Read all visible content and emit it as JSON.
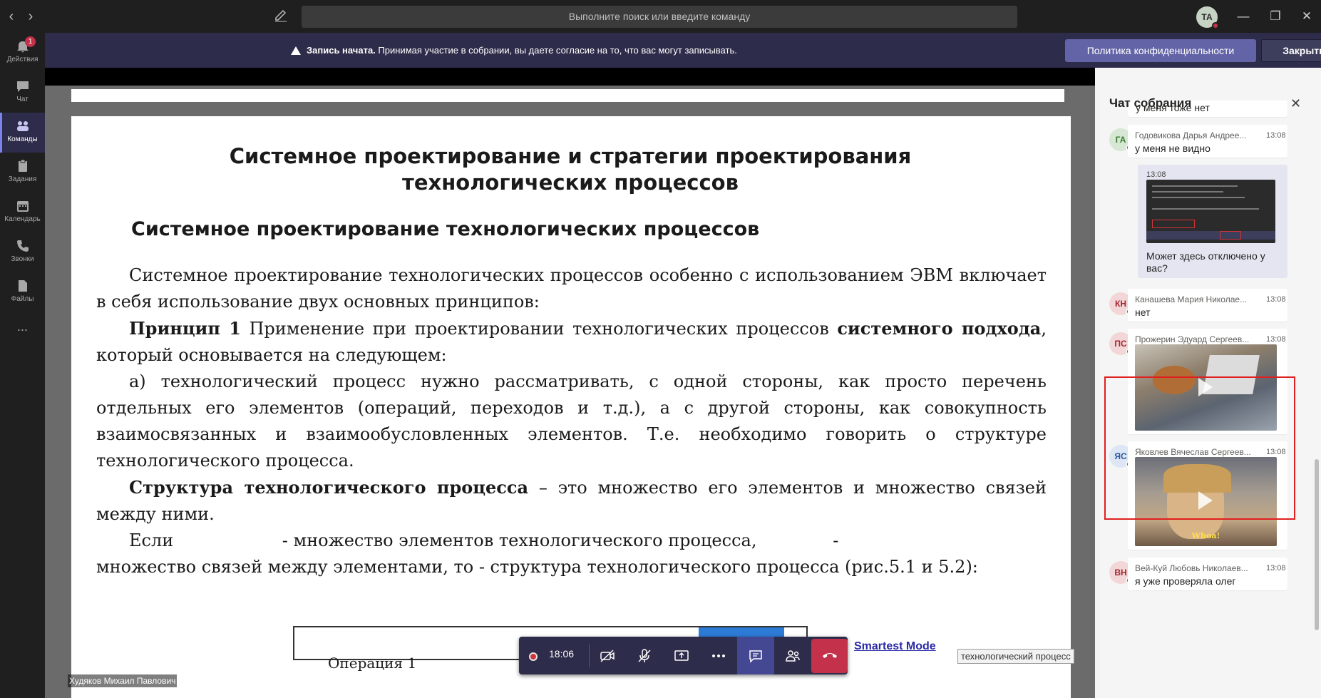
{
  "titlebar": {
    "search_placeholder": "Выполните поиск или введите команду",
    "avatar_initials": "ТА"
  },
  "rail": {
    "items": [
      {
        "label": "Действия",
        "badge": "1"
      },
      {
        "label": "Чат"
      },
      {
        "label": "Команды"
      },
      {
        "label": "Задания"
      },
      {
        "label": "Календарь"
      },
      {
        "label": "Звонки"
      },
      {
        "label": "Файлы"
      }
    ],
    "more": "..."
  },
  "banner": {
    "title": "Запись начата.",
    "text": "Принимая участие в собрании, вы даете согласие на то, что вас могут записывать.",
    "privacy_label": "Политика конфиденциальности",
    "close_label": "Закрыть"
  },
  "document": {
    "title": "Системное проектирование и стратегии проектирования технологических процессов",
    "subtitle": "Системное проектирование технологических процессов",
    "p1": "Системное проектирование технологических процессов особенно с использованием ЭВМ включает в себя использование двух основных принципов:",
    "p2_bold": "Принцип 1",
    "p2": " Применение при проектировании технологических процессов ",
    "p2_bold2": "системного подхода",
    "p2_end": ", который основывается на следующем:",
    "p3": "а) технологический процесс нужно рассматривать, с одной стороны, как просто перечень отдельных его элементов (операций, переходов и т.д.), а с другой стороны, как совокупность взаимосвязанных и взаимообусловленных элементов. Т.е. необходимо говорить о структуре технологического процесса.",
    "p4_bold": "Структура технологического процесса",
    "p4": " – это множество его элементов и множество связей между ними.",
    "p5a": "Если                    - множество элементов технологического процесса,              -",
    "p5b": "множество связей между элементами, то            - структура технологического процесса (рис.5.1 и 5.2):",
    "box_text": "Операция 1",
    "ribbon1": "Smartest Mode",
    "ribbon2": "технологический процесс"
  },
  "presenter_name": "Худяков Михаил Павлович",
  "controls": {
    "timer": "18:06"
  },
  "chat": {
    "title": "Чат собрания",
    "messages": [
      {
        "text": "у меня тоже нет"
      },
      {
        "initials": "ГА",
        "sender": "Годовикова Дарья Андрее...",
        "time": "13:08",
        "text": "у меня не видно",
        "avatar_color": "#d6e7d4",
        "avatar_text_color": "#3b7a31"
      },
      {
        "own": true,
        "time": "13:08",
        "text": "Может здесь отключено у вас?"
      },
      {
        "initials": "КН",
        "sender": "Канашева Мария Николае...",
        "time": "13:08",
        "text": "нет",
        "avatar_color": "#f3d6d8",
        "avatar_text_color": "#a4262c"
      },
      {
        "initials": "ПС",
        "sender": "Прожерин Эдуард Сергеев...",
        "time": "13:08",
        "avatar_color": "#f3d6d8",
        "avatar_text_color": "#a4262c"
      },
      {
        "initials": "ЯС",
        "sender": "Яковлев Вячеслав Сергеев...",
        "time": "13:08",
        "gif_caption": "Whoa!",
        "avatar_color": "#dce6f4",
        "avatar_text_color": "#2b579a"
      },
      {
        "initials": "ВН",
        "sender": "Вей-Куй Любовь Николаев...",
        "time": "13:08",
        "text": "я уже проверяла олег",
        "avatar_color": "#f3d6d8",
        "avatar_text_color": "#a4262c"
      }
    ]
  }
}
